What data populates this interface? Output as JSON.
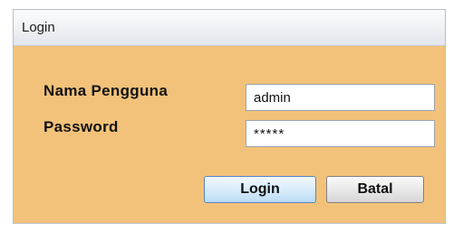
{
  "window": {
    "title": "Login"
  },
  "form": {
    "username_label": "Nama Pengguna",
    "username_value": "admin",
    "password_label": "Password",
    "password_value": "*****"
  },
  "buttons": {
    "login_label": "Login",
    "cancel_label": "Batal"
  }
}
